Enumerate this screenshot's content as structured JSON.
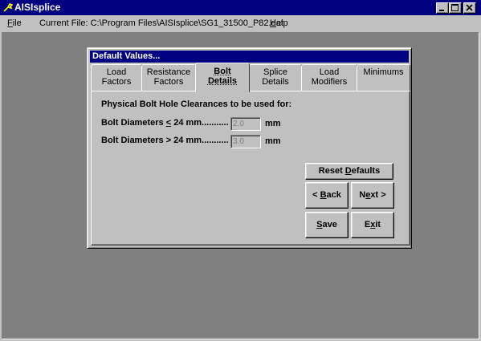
{
  "app": {
    "title": "AISIsplice",
    "icon": "wrench-icon"
  },
  "menu": {
    "file_pre": "",
    "file_u": "F",
    "file_post": "ile",
    "current_file": "Current File:  C:\\Program Files\\AISIsplice\\SG1_31500_P82.dat",
    "help_pre": "",
    "help_u": "H",
    "help_post": "elp"
  },
  "dialog": {
    "title": "Default Values...",
    "tabs": [
      {
        "label": "Load\nFactors",
        "active": false
      },
      {
        "label": "Resistance\nFactors",
        "active": false
      },
      {
        "label": "Bolt\nDetails",
        "active": true
      },
      {
        "label": "Splice\nDetails",
        "active": false
      },
      {
        "label": "Load\nModifiers",
        "active": false
      },
      {
        "label": "Minimums",
        "active": false
      }
    ],
    "heading": "Physical Bolt Hole Clearances to be used for:",
    "row1": {
      "label_pre": "Bolt Diameters ",
      "label_sym": "<",
      "label_post": " 24 mm...........",
      "value": "2.0",
      "unit": "mm"
    },
    "row2": {
      "label": "Bolt Diameters > 24 mm...........",
      "value": "3.0",
      "unit": "mm"
    },
    "buttons": {
      "reset_pre": "Reset ",
      "reset_u": "D",
      "reset_post": "efaults",
      "back_pre": "< ",
      "back_u": "B",
      "back_post": "ack",
      "next_pre": "N",
      "next_u": "e",
      "next_post": "xt >",
      "save_u": "S",
      "save_post": "ave",
      "exit_pre": "E",
      "exit_u": "x",
      "exit_post": "it"
    }
  },
  "colors": {
    "titlebar": "#000080",
    "face": "#c0c0c0",
    "workspace": "#808080"
  }
}
